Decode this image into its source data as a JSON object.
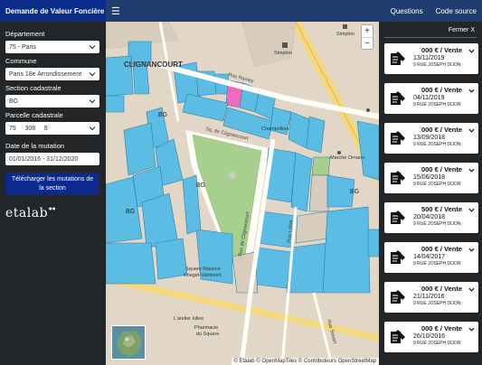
{
  "header": {
    "title": "Demande de Valeur Foncière",
    "menu_icon": "hamburger-icon",
    "links": [
      "Questions",
      "Code source"
    ]
  },
  "sidebar": {
    "departement_label": "Département",
    "departement_value": "75 - Paris",
    "commune_label": "Commune",
    "commune_value": "Paris 18e Arrondissement",
    "section_label": "Section cadastrale",
    "section_value": "BG",
    "parcelle_label": "Parcelle cadastrale",
    "parcelle_value": "75     308     8",
    "date_label": "Date de la mutation",
    "date_value": "01/01/2016 - 31/12/2020",
    "download_label": "Télécharger les mutations de la section",
    "logo_text": "etalab"
  },
  "map": {
    "zoom_in": "+",
    "zoom_out": "−",
    "attribution": "© Etalab © OpenMapTiles © Contributeurs OpenStreetMap",
    "labels": {
      "clignancourt": "CLIGNANCOURT",
      "bg1": "BG",
      "bg2": "BG",
      "bg3": "BG",
      "bg4": "BG",
      "rue_ramey": "Rue Ramey",
      "sq_clignancourt": "Sq. de Clignancourt",
      "rue_clignancourt": "Rue de Clignancourt",
      "rue_labat": "Rue Labat",
      "rue_simart": "Rue Simart",
      "square": "Square Maurice",
      "square2": "Kriegel-Valrimont",
      "simplon1": "Simplon",
      "simplon2": "Simplon",
      "marche": "Marché Ornano",
      "pharmacie": "Pharmacie",
      "pharmacie2": "du Square",
      "atelier": "L'atelier lulles",
      "champollion": "Champollion"
    },
    "colors": {
      "parcel": "#5bbde3",
      "highlight": "#f06bbd",
      "park": "#a7cf8e",
      "road": "#fffdf8",
      "major_road": "#f6d77a"
    }
  },
  "panel": {
    "close_label": "Fermer X",
    "cards": [
      {
        "price": "000 € / Vente",
        "date": "13/11/2019",
        "address": "9 RUE JOSEPH DIJON"
      },
      {
        "price": "000 € / Vente",
        "date": "04/11/2019",
        "address": "9 RUE JOSEPH DIJON"
      },
      {
        "price": "000 € / Vente",
        "date": "13/09/2018",
        "address": "9 RUE JOSEPH DIJON"
      },
      {
        "price": "000 € / Vente",
        "date": "15/06/2018",
        "address": "9 RUE JOSEPH DIJON"
      },
      {
        "price": "500 € / Vente",
        "date": "20/04/2018",
        "address": "9 RUE JOSEPH DIJON"
      },
      {
        "price": "000 € / Vente",
        "date": "14/04/2017",
        "address": "9 RUE JOSEPH DIJON"
      },
      {
        "price": "000 € / Vente",
        "date": "21/11/2016",
        "address": "9 RUE JOSEPH DIJON"
      },
      {
        "price": "000 € / Vente",
        "date": "26/10/2016",
        "address": "9 RUE JOSEPH DIJON"
      }
    ],
    "card_icon": "sale-document-icon"
  }
}
